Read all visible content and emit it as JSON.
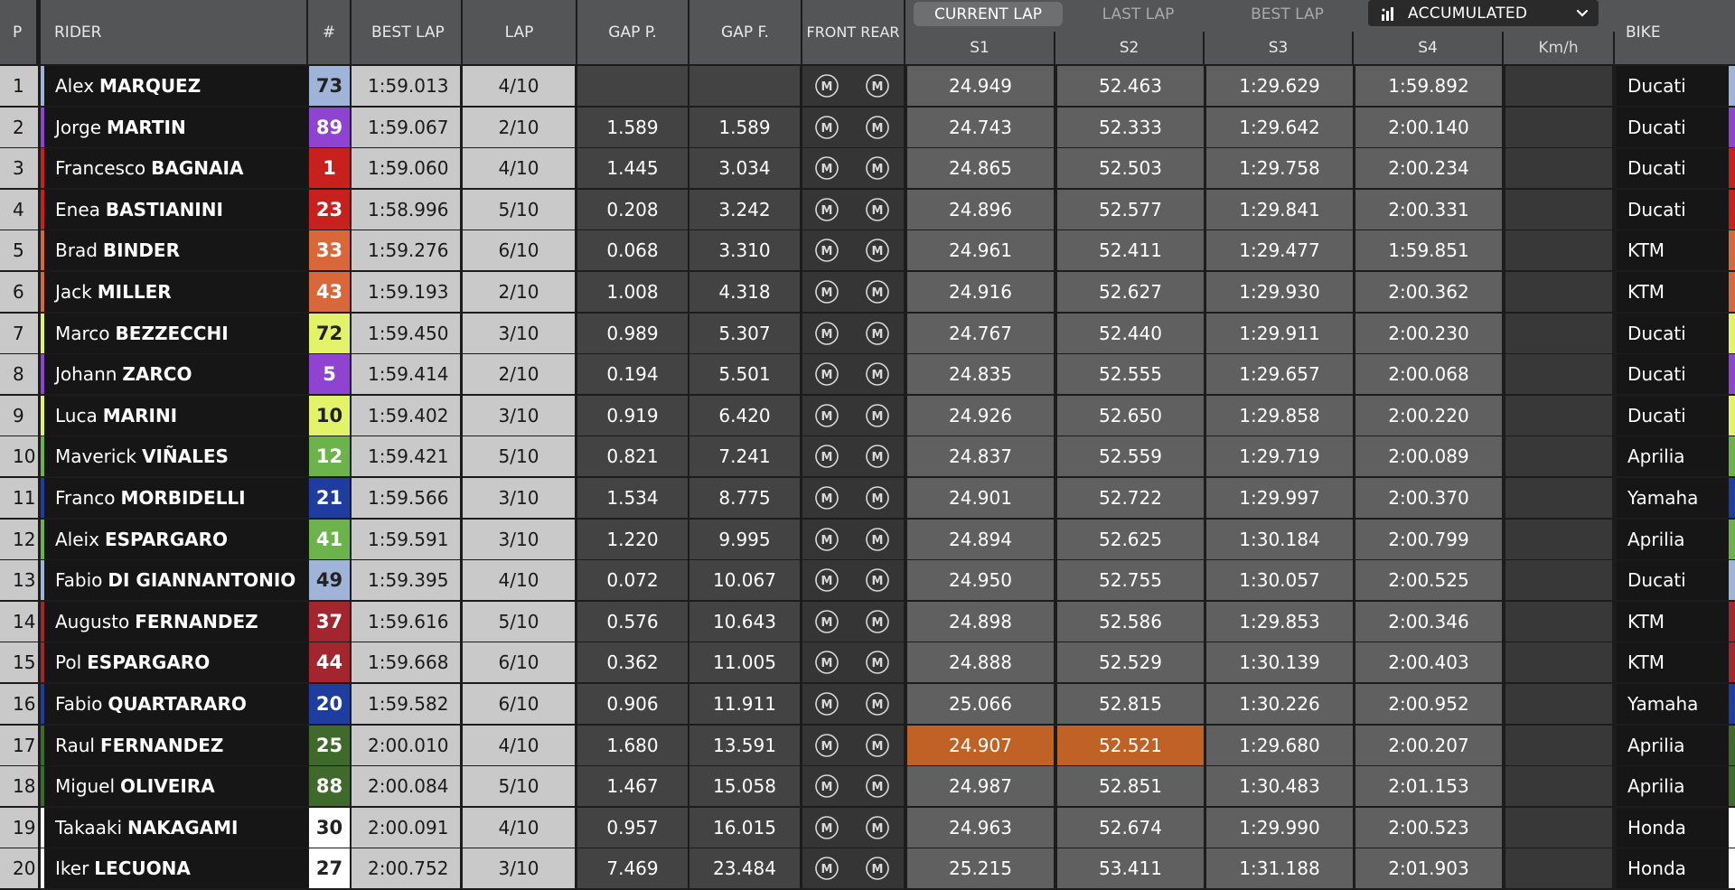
{
  "headers": {
    "p": "P",
    "rider": "RIDER",
    "num": "#",
    "best_lap": "BEST LAP",
    "lap": "LAP",
    "gap_p": "GAP P.",
    "gap_f": "GAP F.",
    "front_rear": "FRONT REAR",
    "bike": "BIKE",
    "s1": "S1",
    "s2": "S2",
    "s3": "S3",
    "s4": "S4",
    "kmh": "Km/h"
  },
  "tabs": [
    {
      "label": "CURRENT LAP",
      "active": true
    },
    {
      "label": "LAST LAP",
      "active": false
    },
    {
      "label": "BEST LAP",
      "active": false
    }
  ],
  "dropdown": {
    "label": "ACCUMULATED",
    "icon": "bar-chart-icon",
    "chevron": "chevron-down-icon"
  },
  "tyre_icon": {
    "name": "tyre-medium-icon",
    "letter": "M"
  },
  "colors": {
    "sector_highlight": "#c06226"
  },
  "rows": [
    {
      "pos": "1",
      "first": "Alex",
      "last": "MARQUEZ",
      "num": "73",
      "num_bg": "#9fb4d8",
      "num_fg": "#222222",
      "stripe": "#9fb4d8",
      "best": "1:59.013",
      "lap": "4/10",
      "gap_p": "",
      "gap_f": "",
      "front": "M",
      "rear": "M",
      "s1": "24.949",
      "s2": "52.463",
      "s3": "1:29.629",
      "s4": "1:59.892",
      "s1_hl": false,
      "s2_hl": false,
      "kmh": "",
      "bike": "Ducati"
    },
    {
      "pos": "2",
      "first": "Jorge",
      "last": "MARTIN",
      "num": "89",
      "num_bg": "#8e44d0",
      "num_fg": "#ffffff",
      "stripe": "#8e44d0",
      "best": "1:59.067",
      "lap": "2/10",
      "gap_p": "1.589",
      "gap_f": "1.589",
      "front": "M",
      "rear": "M",
      "s1": "24.743",
      "s2": "52.333",
      "s3": "1:29.642",
      "s4": "2:00.140",
      "s1_hl": false,
      "s2_hl": false,
      "kmh": "",
      "bike": "Ducati"
    },
    {
      "pos": "3",
      "first": "Francesco",
      "last": "BAGNAIA",
      "num": "1",
      "num_bg": "#c8201d",
      "num_fg": "#ffffff",
      "stripe": "#c8201d",
      "best": "1:59.060",
      "lap": "4/10",
      "gap_p": "1.445",
      "gap_f": "3.034",
      "front": "M",
      "rear": "M",
      "s1": "24.865",
      "s2": "52.503",
      "s3": "1:29.758",
      "s4": "2:00.234",
      "s1_hl": false,
      "s2_hl": false,
      "kmh": "",
      "bike": "Ducati"
    },
    {
      "pos": "4",
      "first": "Enea",
      "last": "BASTIANINI",
      "num": "23",
      "num_bg": "#c8201d",
      "num_fg": "#ffffff",
      "stripe": "#c8201d",
      "best": "1:58.996",
      "lap": "5/10",
      "gap_p": "0.208",
      "gap_f": "3.242",
      "front": "M",
      "rear": "M",
      "s1": "24.896",
      "s2": "52.577",
      "s3": "1:29.841",
      "s4": "2:00.331",
      "s1_hl": false,
      "s2_hl": false,
      "kmh": "",
      "bike": "Ducati"
    },
    {
      "pos": "5",
      "first": "Brad",
      "last": "BINDER",
      "num": "33",
      "num_bg": "#d8683a",
      "num_fg": "#ffffff",
      "stripe": "#d8683a",
      "best": "1:59.276",
      "lap": "6/10",
      "gap_p": "0.068",
      "gap_f": "3.310",
      "front": "M",
      "rear": "M",
      "s1": "24.961",
      "s2": "52.411",
      "s3": "1:29.477",
      "s4": "1:59.851",
      "s1_hl": false,
      "s2_hl": false,
      "kmh": "",
      "bike": "KTM"
    },
    {
      "pos": "6",
      "first": "Jack",
      "last": "MILLER",
      "num": "43",
      "num_bg": "#d8683a",
      "num_fg": "#ffffff",
      "stripe": "#d8683a",
      "best": "1:59.193",
      "lap": "2/10",
      "gap_p": "1.008",
      "gap_f": "4.318",
      "front": "M",
      "rear": "M",
      "s1": "24.916",
      "s2": "52.627",
      "s3": "1:29.930",
      "s4": "2:00.362",
      "s1_hl": false,
      "s2_hl": false,
      "kmh": "",
      "bike": "KTM"
    },
    {
      "pos": "7",
      "first": "Marco",
      "last": "BEZZECCHI",
      "num": "72",
      "num_bg": "#e2f36a",
      "num_fg": "#222222",
      "stripe": "#e2f36a",
      "best": "1:59.450",
      "lap": "3/10",
      "gap_p": "0.989",
      "gap_f": "5.307",
      "front": "M",
      "rear": "M",
      "s1": "24.767",
      "s2": "52.440",
      "s3": "1:29.911",
      "s4": "2:00.230",
      "s1_hl": false,
      "s2_hl": false,
      "kmh": "",
      "bike": "Ducati"
    },
    {
      "pos": "8",
      "first": "Johann",
      "last": "ZARCO",
      "num": "5",
      "num_bg": "#8e44d0",
      "num_fg": "#ffffff",
      "stripe": "#8e44d0",
      "best": "1:59.414",
      "lap": "2/10",
      "gap_p": "0.194",
      "gap_f": "5.501",
      "front": "M",
      "rear": "M",
      "s1": "24.835",
      "s2": "52.555",
      "s3": "1:29.657",
      "s4": "2:00.068",
      "s1_hl": false,
      "s2_hl": false,
      "kmh": "",
      "bike": "Ducati"
    },
    {
      "pos": "9",
      "first": "Luca",
      "last": "MARINI",
      "num": "10",
      "num_bg": "#e2f36a",
      "num_fg": "#222222",
      "stripe": "#e2f36a",
      "best": "1:59.402",
      "lap": "3/10",
      "gap_p": "0.919",
      "gap_f": "6.420",
      "front": "M",
      "rear": "M",
      "s1": "24.926",
      "s2": "52.650",
      "s3": "1:29.858",
      "s4": "2:00.220",
      "s1_hl": false,
      "s2_hl": false,
      "kmh": "",
      "bike": "Ducati"
    },
    {
      "pos": "10",
      "first": "Maverick",
      "last": "VIÑALES",
      "num": "12",
      "num_bg": "#6bb34a",
      "num_fg": "#ffffff",
      "stripe": "#6bb34a",
      "best": "1:59.421",
      "lap": "5/10",
      "gap_p": "0.821",
      "gap_f": "7.241",
      "front": "M",
      "rear": "M",
      "s1": "24.837",
      "s2": "52.559",
      "s3": "1:29.719",
      "s4": "2:00.089",
      "s1_hl": false,
      "s2_hl": false,
      "kmh": "",
      "bike": "Aprilia"
    },
    {
      "pos": "11",
      "first": "Franco",
      "last": "MORBIDELLI",
      "num": "21",
      "num_bg": "#1f3d9e",
      "num_fg": "#ffffff",
      "stripe": "#1f3d9e",
      "best": "1:59.566",
      "lap": "3/10",
      "gap_p": "1.534",
      "gap_f": "8.775",
      "front": "M",
      "rear": "M",
      "s1": "24.901",
      "s2": "52.722",
      "s3": "1:29.997",
      "s4": "2:00.370",
      "s1_hl": false,
      "s2_hl": false,
      "kmh": "",
      "bike": "Yamaha"
    },
    {
      "pos": "12",
      "first": "Aleix",
      "last": "ESPARGARO",
      "num": "41",
      "num_bg": "#6bb34a",
      "num_fg": "#ffffff",
      "stripe": "#6bb34a",
      "best": "1:59.591",
      "lap": "3/10",
      "gap_p": "1.220",
      "gap_f": "9.995",
      "front": "M",
      "rear": "M",
      "s1": "24.894",
      "s2": "52.625",
      "s3": "1:30.184",
      "s4": "2:00.799",
      "s1_hl": false,
      "s2_hl": false,
      "kmh": "",
      "bike": "Aprilia"
    },
    {
      "pos": "13",
      "first": "Fabio",
      "last": "DI GIANNANTONIO",
      "num": "49",
      "num_bg": "#9fb4d8",
      "num_fg": "#222222",
      "stripe": "#9fb4d8",
      "best": "1:59.395",
      "lap": "4/10",
      "gap_p": "0.072",
      "gap_f": "10.067",
      "front": "M",
      "rear": "M",
      "s1": "24.950",
      "s2": "52.755",
      "s3": "1:30.057",
      "s4": "2:00.525",
      "s1_hl": false,
      "s2_hl": false,
      "kmh": "",
      "bike": "Ducati"
    },
    {
      "pos": "14",
      "first": "Augusto",
      "last": "FERNANDEZ",
      "num": "37",
      "num_bg": "#a3262e",
      "num_fg": "#ffffff",
      "stripe": "#a3262e",
      "best": "1:59.616",
      "lap": "5/10",
      "gap_p": "0.576",
      "gap_f": "10.643",
      "front": "M",
      "rear": "M",
      "s1": "24.898",
      "s2": "52.586",
      "s3": "1:29.853",
      "s4": "2:00.346",
      "s1_hl": false,
      "s2_hl": false,
      "kmh": "",
      "bike": "KTM"
    },
    {
      "pos": "15",
      "first": "Pol",
      "last": "ESPARGARO",
      "num": "44",
      "num_bg": "#a3262e",
      "num_fg": "#ffffff",
      "stripe": "#a3262e",
      "best": "1:59.668",
      "lap": "6/10",
      "gap_p": "0.362",
      "gap_f": "11.005",
      "front": "M",
      "rear": "M",
      "s1": "24.888",
      "s2": "52.529",
      "s3": "1:30.139",
      "s4": "2:00.403",
      "s1_hl": false,
      "s2_hl": false,
      "kmh": "",
      "bike": "KTM"
    },
    {
      "pos": "16",
      "first": "Fabio",
      "last": "QUARTARARO",
      "num": "20",
      "num_bg": "#1f3d9e",
      "num_fg": "#ffffff",
      "stripe": "#1f3d9e",
      "best": "1:59.582",
      "lap": "6/10",
      "gap_p": "0.906",
      "gap_f": "11.911",
      "front": "M",
      "rear": "M",
      "s1": "25.066",
      "s2": "52.815",
      "s3": "1:30.226",
      "s4": "2:00.952",
      "s1_hl": false,
      "s2_hl": false,
      "kmh": "",
      "bike": "Yamaha"
    },
    {
      "pos": "17",
      "first": "Raul",
      "last": "FERNANDEZ",
      "num": "25",
      "num_bg": "#3f6a2b",
      "num_fg": "#ffffff",
      "stripe": "#3f6a2b",
      "best": "2:00.010",
      "lap": "4/10",
      "gap_p": "1.680",
      "gap_f": "13.591",
      "front": "M",
      "rear": "M",
      "s1": "24.907",
      "s2": "52.521",
      "s3": "1:29.680",
      "s4": "2:00.207",
      "s1_hl": true,
      "s2_hl": true,
      "kmh": "",
      "bike": "Aprilia"
    },
    {
      "pos": "18",
      "first": "Miguel",
      "last": "OLIVEIRA",
      "num": "88",
      "num_bg": "#3f6a2b",
      "num_fg": "#ffffff",
      "stripe": "#3f6a2b",
      "best": "2:00.084",
      "lap": "5/10",
      "gap_p": "1.467",
      "gap_f": "15.058",
      "front": "M",
      "rear": "M",
      "s1": "24.987",
      "s2": "52.851",
      "s3": "1:30.483",
      "s4": "2:01.153",
      "s1_hl": false,
      "s2_hl": false,
      "kmh": "",
      "bike": "Aprilia"
    },
    {
      "pos": "19",
      "first": "Takaaki",
      "last": "NAKAGAMI",
      "num": "30",
      "num_bg": "#ffffff",
      "num_fg": "#222222",
      "stripe": "#ffffff",
      "best": "2:00.091",
      "lap": "4/10",
      "gap_p": "0.957",
      "gap_f": "16.015",
      "front": "M",
      "rear": "M",
      "s1": "24.963",
      "s2": "52.674",
      "s3": "1:29.990",
      "s4": "2:00.523",
      "s1_hl": false,
      "s2_hl": false,
      "kmh": "",
      "bike": "Honda"
    },
    {
      "pos": "20",
      "first": "Iker",
      "last": "LECUONA",
      "num": "27",
      "num_bg": "#ffffff",
      "num_fg": "#222222",
      "stripe": "#ffffff",
      "best": "2:00.752",
      "lap": "3/10",
      "gap_p": "7.469",
      "gap_f": "23.484",
      "front": "M",
      "rear": "M",
      "s1": "25.215",
      "s2": "53.411",
      "s3": "1:31.188",
      "s4": "2:01.903",
      "s1_hl": false,
      "s2_hl": false,
      "kmh": "",
      "bike": "Honda"
    }
  ]
}
